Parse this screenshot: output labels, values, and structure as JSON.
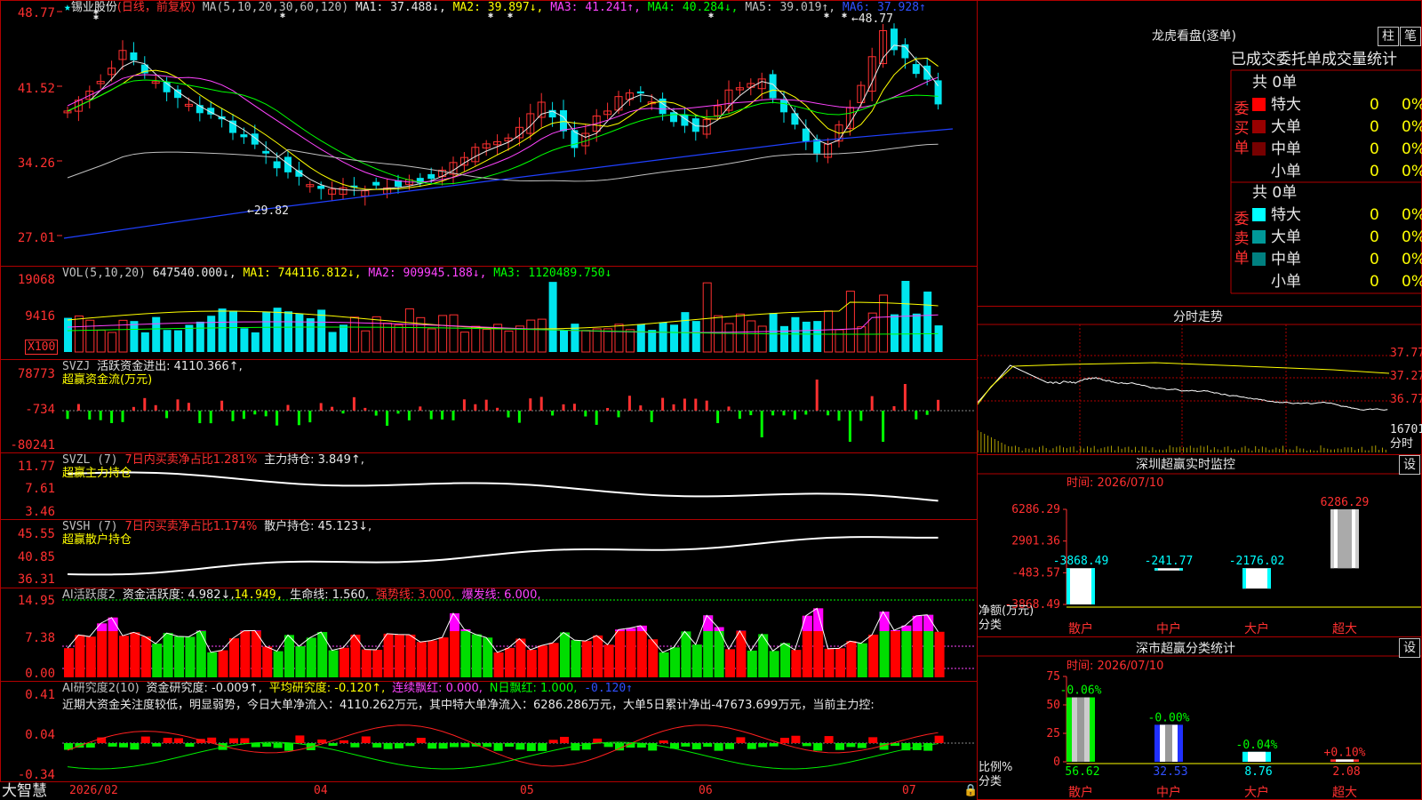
{
  "header": {
    "star": "★",
    "stock_name": "锡业股份",
    "period": "(日线，前复权)",
    "ma_label": "MA(5,10,20,30,60,120)",
    "ma1": "MA1: 37.488↓,",
    "ma2": "MA2: 39.897↓,",
    "ma3": "MA3: 41.241↑,",
    "ma4": "MA4: 40.284↓,",
    "ma5": "MA5: 39.019↑,",
    "ma6": "MA6: 37.928↑"
  },
  "price_axis": [
    "48.77",
    "41.52",
    "34.26",
    "27.01"
  ],
  "price_annotations": {
    "high": "48.77",
    "low": "29.82"
  },
  "vol_panel": {
    "label": "VOL(5,10,20)",
    "value": "647540.000↓,",
    "ma1": "MA1: 744116.812↓,",
    "ma2": "MA2: 909945.188↓,",
    "ma3": "MA3: 1120489.750↓",
    "axis": [
      "19068",
      "9416"
    ],
    "unit": "X100"
  },
  "svzj_panel": {
    "label": "SVZJ",
    "text": "活跃资金进出: 4110.366↑,",
    "subtitle": "超赢资金流(万元)",
    "axis": [
      "78773",
      "-734",
      "-80241"
    ]
  },
  "svzl_panel": {
    "label": "SVZL (7)",
    "ratio": "7日内买卖净占比1.281%",
    "holding": "主力持仓: 3.849↑,",
    "subtitle": "超赢主力持仓",
    "axis": [
      "11.77",
      "7.61",
      "3.46"
    ]
  },
  "svsh_panel": {
    "label": "SVSH (7)",
    "ratio": "7日内买卖净占比1.174%",
    "holding": "散户持仓: 45.123↓,",
    "subtitle": "超赢散户持仓",
    "axis": [
      "45.55",
      "40.85",
      "36.31"
    ]
  },
  "ai_active_panel": {
    "label": "AI活跃度2",
    "active": "资金活跃度: 4.982↓,",
    "v2": "14.949,",
    "life": "生命线: 1.560,",
    "strong": "强势线: 3.000,",
    "burst": "爆发线: 6.000,",
    "axis": [
      "14.95",
      "7.38",
      "0.00"
    ]
  },
  "ai_research_panel": {
    "label": "AI研究度2(10)",
    "research": "资金研究度: -0.009↑,",
    "avg": "平均研究度: -0.120↑,",
    "red": "连续飘红: 0.000,",
    "nred": "N日飘红: 1.000,",
    "neg": "-0.120↑",
    "comment": "近期大资金关注度较低，明显弱势，今日大单净流入：4110.262万元，其中特大单净流入：6286.286万元，大单5日累计净出-47673.699万元，当前主力控:",
    "axis": [
      "0.41",
      "0.04",
      "-0.34"
    ]
  },
  "bottom_axis": {
    "brand": "大智慧",
    "dates": [
      "2026/02",
      "04",
      "05",
      "06",
      "07"
    ]
  },
  "lhb": {
    "title": "龙虎看盘(逐单)",
    "btn_zhu": "柱",
    "btn_bi": "笔",
    "header": "已成交委托单成交量统计",
    "buy_label": "委买单",
    "sell_label": "委卖单",
    "buy_total": "共 0单",
    "sell_total": "共 0单",
    "buy_rows": [
      {
        "name": "特大",
        "qty": "0",
        "pct": "0%",
        "color": "#ff0000"
      },
      {
        "name": "大单",
        "qty": "0",
        "pct": "0%",
        "color": "#990000"
      },
      {
        "name": "中单",
        "qty": "0",
        "pct": "0%",
        "color": "#770000"
      },
      {
        "name": "小单",
        "qty": "0",
        "pct": "0%",
        "color": ""
      }
    ],
    "sell_rows": [
      {
        "name": "特大",
        "qty": "0",
        "pct": "0%",
        "color": "#00ffff"
      },
      {
        "name": "大单",
        "qty": "0",
        "pct": "0%",
        "color": "#009999"
      },
      {
        "name": "中单",
        "qty": "0",
        "pct": "0%",
        "color": "#008080"
      },
      {
        "name": "小单",
        "qty": "0",
        "pct": "0%",
        "color": ""
      }
    ]
  },
  "intraday": {
    "title": "分时走势",
    "axis": [
      "37.77",
      "37.27",
      "36.77"
    ],
    "vol_label": "16701",
    "fs_label": "分时"
  },
  "realtime_monitor": {
    "title": "深圳超赢实时监控",
    "btn": "设",
    "time": "时间: 2026/07/10",
    "axis": [
      "6286.29",
      "2901.36",
      "-483.57",
      "-3868.49"
    ],
    "ylabel": "净额(万元)",
    "xlabel": "分类",
    "categories": [
      "散户",
      "中户",
      "大户",
      "超大"
    ],
    "values": [
      -3868.49,
      -241.77,
      -2176.02,
      6286.29
    ],
    "value_labels": [
      "-3868.49",
      "-241.77",
      "-2176.02",
      "6286.29"
    ]
  },
  "class_stats": {
    "title": "深市超赢分类统计",
    "btn": "设",
    "time": "时间: 2026/07/10",
    "axis": [
      "75",
      "50",
      "25",
      "0"
    ],
    "ylabel": "比例%",
    "xlabel": "分类",
    "categories": [
      "散户",
      "中户",
      "大户",
      "超大"
    ],
    "values": [
      56.62,
      32.53,
      8.76,
      2.08
    ],
    "value_labels": [
      "56.62",
      "32.53",
      "8.76",
      "2.08"
    ],
    "change_labels": [
      "-0.06%",
      "-0.00%",
      "-0.04%",
      "+0.10%"
    ]
  }
}
